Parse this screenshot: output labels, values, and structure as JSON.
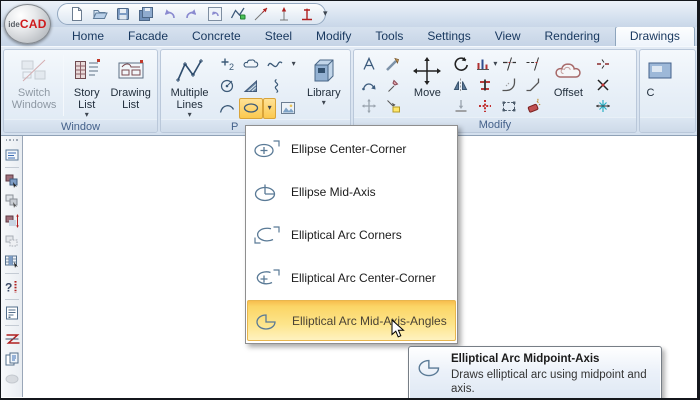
{
  "logo": {
    "prefix": "ide",
    "brand": "CAD"
  },
  "ui": {
    "caret": "▾",
    "qat_more": "▾"
  },
  "tabs": {
    "items": [
      "Home",
      "Facade",
      "Concrete",
      "Steel",
      "Modify",
      "Tools",
      "Settings",
      "View",
      "Rendering",
      "Drawings"
    ],
    "active": "Drawings"
  },
  "ribbon": {
    "window_group": {
      "label": "Window",
      "switch_windows": "Switch Windows",
      "story_list": "Story List",
      "drawing_list": "Drawing List"
    },
    "draw_group": {
      "label_partial": "P",
      "multiple_lines": "Multiple Lines",
      "library": "Library"
    },
    "modify_group": {
      "label": "Modify",
      "move": "Move",
      "offset": "Offset"
    },
    "partial_group": {
      "label_partial": "C"
    }
  },
  "dropdown": {
    "items": [
      {
        "label": "Ellipse Center-Corner",
        "icon": "ellipse-center-corner-icon",
        "highlighted": false
      },
      {
        "label": "Ellipse Mid-Axis",
        "icon": "ellipse-mid-axis-icon",
        "highlighted": false
      },
      {
        "label": "Elliptical Arc Corners",
        "icon": "elliptical-arc-corners-icon",
        "highlighted": false
      },
      {
        "label": "Elliptical Arc Center-Corner",
        "icon": "elliptical-arc-center-corner-icon",
        "highlighted": false
      },
      {
        "label": "Elliptical Arc Mid-Axis-Angles",
        "icon": "elliptical-arc-mid-axis-angles-icon",
        "highlighted": true
      }
    ]
  },
  "tooltip": {
    "title": "Elliptical Arc Midpoint-Axis",
    "description": "Draws elliptical arc using midpoint and axis."
  },
  "icons": {
    "caret-down": "▾",
    "new-file": "svg-shape",
    "open-file": "svg-shape",
    "save": "svg-shape",
    "save-all": "svg-shape",
    "undo": "svg-shape",
    "redo": "svg-shape",
    "undo-view": "svg-shape",
    "polyline-lock": "svg-shape",
    "pick-point": "svg-shape",
    "pick-vertical": "svg-shape",
    "dimension": "svg-shape",
    "multiple-lines": "svg-shape",
    "offset-copy": "svg-shape",
    "revision-cloud": "svg-shape",
    "spline": "svg-shape",
    "circle": "svg-shape",
    "hatch": "svg-shape",
    "freehand": "svg-shape",
    "arc": "svg-shape",
    "ellipse": "svg-shape",
    "image": "svg-shape",
    "library": "svg-shape",
    "move": "svg-shape",
    "rotate": "svg-shape",
    "mirror": "svg-shape",
    "offset-cloud": "svg-shape",
    "explode": "svg-shape",
    "trim": "svg-shape",
    "extend": "svg-shape",
    "fillet": "svg-shape"
  },
  "colors": {
    "accent_orange": "#fbd566",
    "brand_red": "#cf1a1c",
    "tab_text": "#17375e",
    "ribbon_bg": "#dce6f2"
  }
}
